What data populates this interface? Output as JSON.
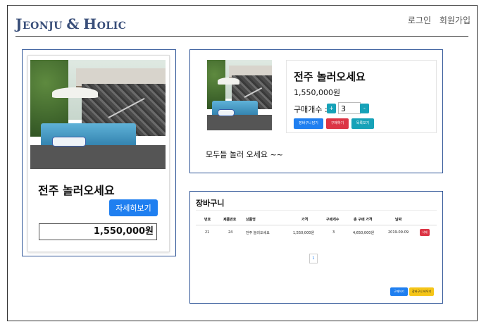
{
  "header": {
    "logo_j": "J",
    "logo_rest1": "EONJU",
    "logo_amp": "&",
    "logo_h": "H",
    "logo_rest2": "OLIC",
    "login": "로그인",
    "signup": "회원가입"
  },
  "product_card": {
    "title": "전주 놀러오세요",
    "detail_button": "자세히보기",
    "price": "1,550,000원"
  },
  "product_detail": {
    "title": "전주 놀러오세요",
    "price": "1,550,000원",
    "qty_label": "구매개수 :",
    "qty_plus": "+",
    "qty_value": "3",
    "qty_minus": "-",
    "cart_button": "장바구니담기",
    "buy_button": "구매하기",
    "list_button": "목록보기",
    "comment": "모두들 놀러 오세요 ~~"
  },
  "cart": {
    "title": "장바구니",
    "headers": [
      "번호",
      "제품번호",
      "상품명",
      "가격",
      "구매개수",
      "총 구매 가격",
      "날짜"
    ],
    "rows": [
      [
        "21",
        "24",
        "전주 놀러오세요",
        "1,550,000원",
        "3",
        "4,650,000원",
        "2019-09-09"
      ]
    ],
    "delete_button": "삭제",
    "page": "1",
    "buy_button": "구매하기",
    "clear_button": "장바구니 비우기"
  },
  "colors": {
    "primary": "#1f7ff0",
    "danger": "#dc3545",
    "info": "#17a2b8",
    "warning": "#f5c518",
    "border": "#2f5597"
  },
  "icons": {
    "product_image": "pool-photo"
  }
}
